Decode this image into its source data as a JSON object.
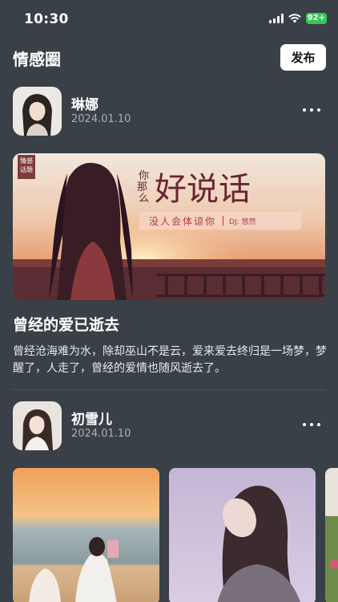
{
  "status_bar": {
    "time": "10:30",
    "battery": "92+"
  },
  "header": {
    "title": "情感圈",
    "publish_label": "发布"
  },
  "posts": [
    {
      "author": "琳娜",
      "date": "2024.01.10",
      "banner": {
        "tag_line1": "情感",
        "tag_line2": "话题",
        "title_small1": "你",
        "title_small2": "那",
        "title_small3": "么",
        "title_big": "好说话",
        "subtitle": "没人会体谅你",
        "dj": "DJ: 悠然"
      },
      "title": "曾经的爱已逝去",
      "body": "曾经沧海难为水，除却巫山不是云，爱来爱去终归是一场梦，梦醒了，人走了，曾经的爱情也随风逝去了。"
    },
    {
      "author": "初雪儿",
      "date": "2024.01.10"
    }
  ],
  "colors": {
    "background": "#3a4047",
    "battery": "#35c759",
    "accent": "#c0504d"
  }
}
